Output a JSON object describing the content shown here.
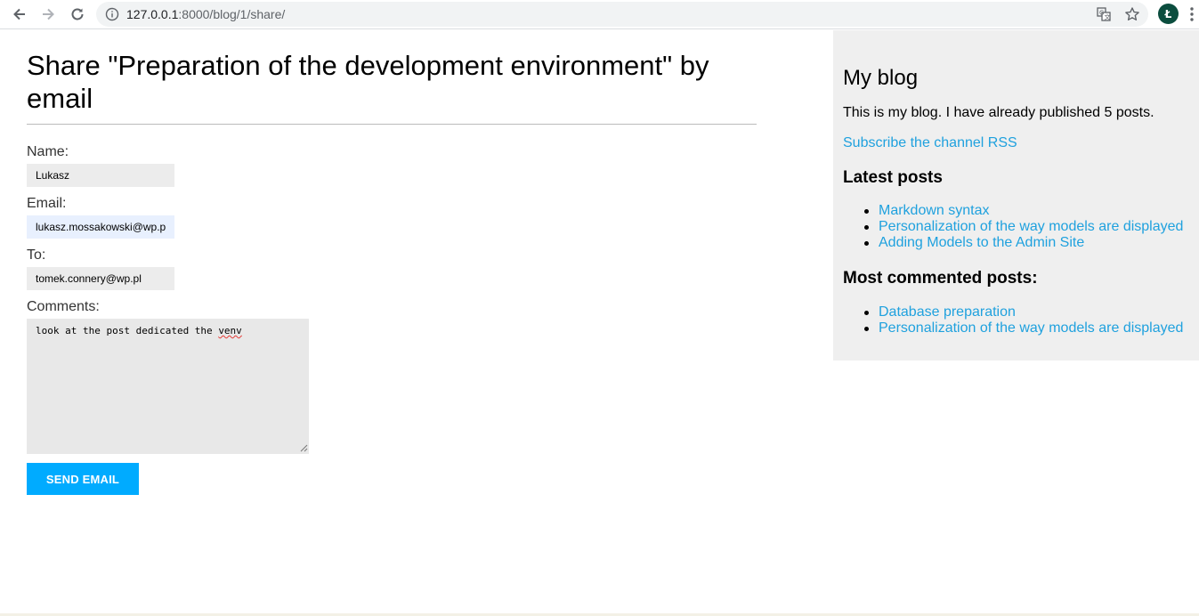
{
  "browser": {
    "url_host": "127.0.0.1",
    "url_path": ":8000/blog/1/share/",
    "avatar_letter": "Ł",
    "accent_color": "#0b4d3e"
  },
  "main": {
    "title": "Share \"Preparation of the development environment\" by email",
    "form": {
      "name_label": "Name:",
      "name_value": "Lukasz",
      "email_label": "Email:",
      "email_value": "lukasz.mossakowski@wp.p",
      "to_label": "To:",
      "to_value": "tomek.connery@wp.pl",
      "comments_label": "Comments:",
      "comments_text": "look at the post dedicated the ",
      "comments_misspelled": "venv",
      "submit_label": "SEND EMAIL",
      "submit_color": "#00abff"
    }
  },
  "sidebar": {
    "title": "My blog",
    "description": "This is my blog. I have already published 5 posts.",
    "rss_link": "Subscribe the channel RSS",
    "link_color": "#1fa1de",
    "latest_heading": "Latest posts",
    "latest_posts": [
      "Markdown syntax",
      "Personalization of the way models are displayed",
      "Adding Models to the Admin Site"
    ],
    "commented_heading": "Most commented posts:",
    "commented_posts": [
      "Database preparation",
      "Personalization of the way models are displayed"
    ]
  }
}
